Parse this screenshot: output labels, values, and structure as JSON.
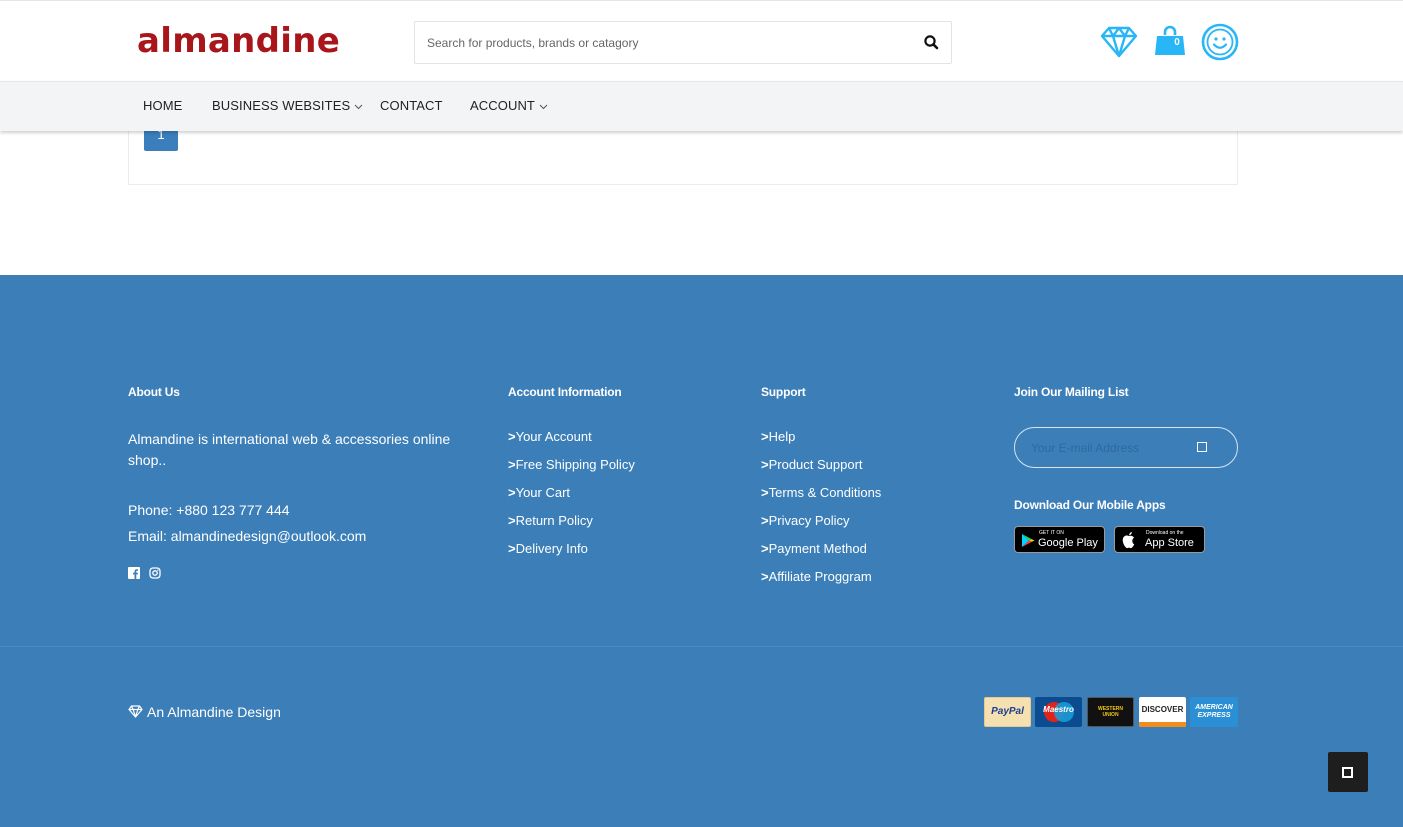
{
  "header": {
    "logo": "almandine",
    "search_placeholder": "Search for products, brands or catagory",
    "cart_count": "0"
  },
  "nav": {
    "items": [
      {
        "label": "HOME",
        "has_dropdown": false
      },
      {
        "label": "BUSINESS WEBSITES",
        "has_dropdown": true
      },
      {
        "label": "CONTACT",
        "has_dropdown": false
      },
      {
        "label": "ACCOUNT",
        "has_dropdown": true
      }
    ]
  },
  "pagination": {
    "current": "1"
  },
  "footer": {
    "about": {
      "heading": "About Us",
      "text": "Almandine is international web & accessories online shop..",
      "phone": "Phone: +880 123 777 444",
      "email": "Email: almandinedesign@outlook.com",
      "social": [
        "facebook-icon",
        "instagram-icon"
      ]
    },
    "account": {
      "heading": "Account Information",
      "links": [
        "Your Account",
        "Free Shipping Policy",
        "Your Cart",
        "Return Policy",
        "Delivery Info"
      ]
    },
    "support": {
      "heading": "Support",
      "links": [
        "Help",
        "Product Support",
        "Terms & Conditions",
        "Privacy Policy",
        "Payment Method",
        "Affiliate Proggram"
      ]
    },
    "mailing": {
      "heading": "Join Our Mailing List",
      "placeholder": "Your E-mail Address",
      "apps_heading": "Download Our Mobile Apps",
      "google_small": "GET IT ON",
      "google_big": "Google Play",
      "apple_small": "Download on the",
      "apple_big": "App Store"
    },
    "credit": "An Almandine Design",
    "payments": [
      "PayPal",
      "Maestro",
      "WESTERN UNION",
      "DISCOVER",
      "AMERICAN EXPRESS"
    ]
  },
  "colors": {
    "brand": "#a8151b",
    "accent": "#29b6f6",
    "footer_bg": "#3b7eb8",
    "button_blue": "#3a7ebb"
  }
}
